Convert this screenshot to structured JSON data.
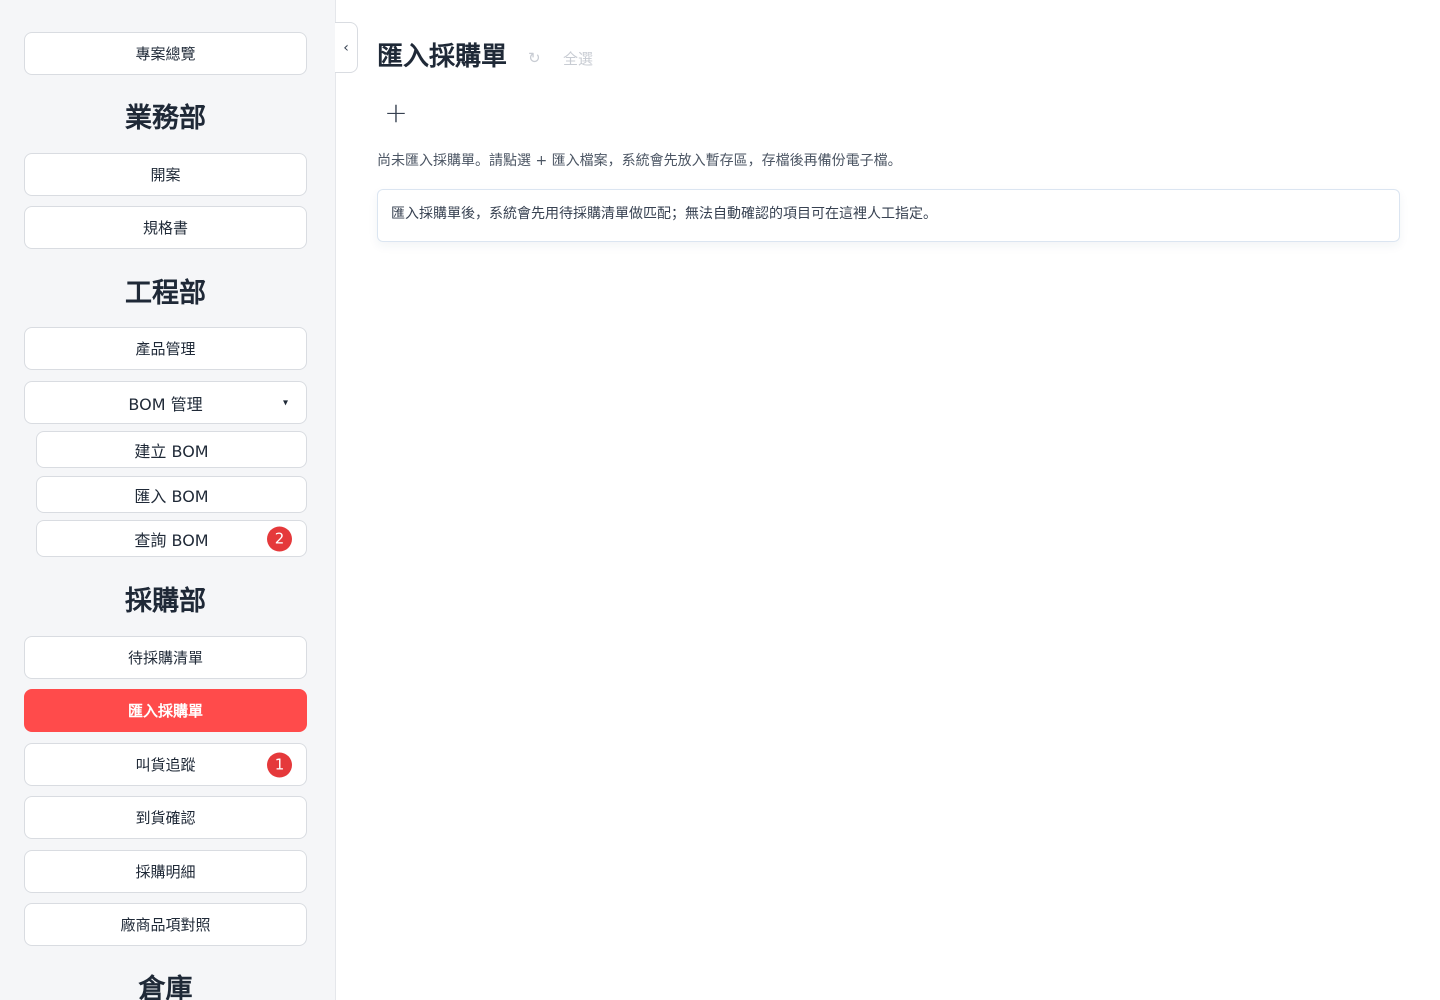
{
  "sidebar": {
    "overview": "專案總覽",
    "sections": {
      "sales": "業務部",
      "engineering": "工程部",
      "purchasing": "採購部",
      "warehouse": "倉庫"
    },
    "sales_items": [
      "開案",
      "規格書"
    ],
    "engineering_items": {
      "product_mgmt": "產品管理",
      "bom_mgmt": "BOM 管理",
      "bom_caret": "▾",
      "bom_sub": {
        "create": "建立 BOM",
        "import": "匯入 BOM",
        "query": "查詢 BOM",
        "query_badge": "2"
      }
    },
    "purchasing_items": {
      "pending_list": "待採購清單",
      "import_po": "匯入採購單",
      "order_tracking": "叫貨追蹤",
      "order_tracking_badge": "1",
      "arrival_confirm": "到貨確認",
      "purchase_detail": "採購明細",
      "vendor_mapping": "廠商品項對照"
    }
  },
  "collapse_icon": "‹",
  "main": {
    "title": "匯入採購單",
    "refresh_icon": "↻",
    "select_all": "全選",
    "plus": "+",
    "hint": "尚未匯入採購單。請點選 + 匯入檔案，系統會先放入暫存區，存檔後再備份電子檔。",
    "info": "匯入採購單後，系統會先用待採購清單做匹配；無法自動確認的項目可在這裡人工指定。"
  },
  "colors": {
    "active": "#ff4b4b",
    "badge": "#e5393b",
    "sidebar_bg": "#f5f6f8"
  }
}
